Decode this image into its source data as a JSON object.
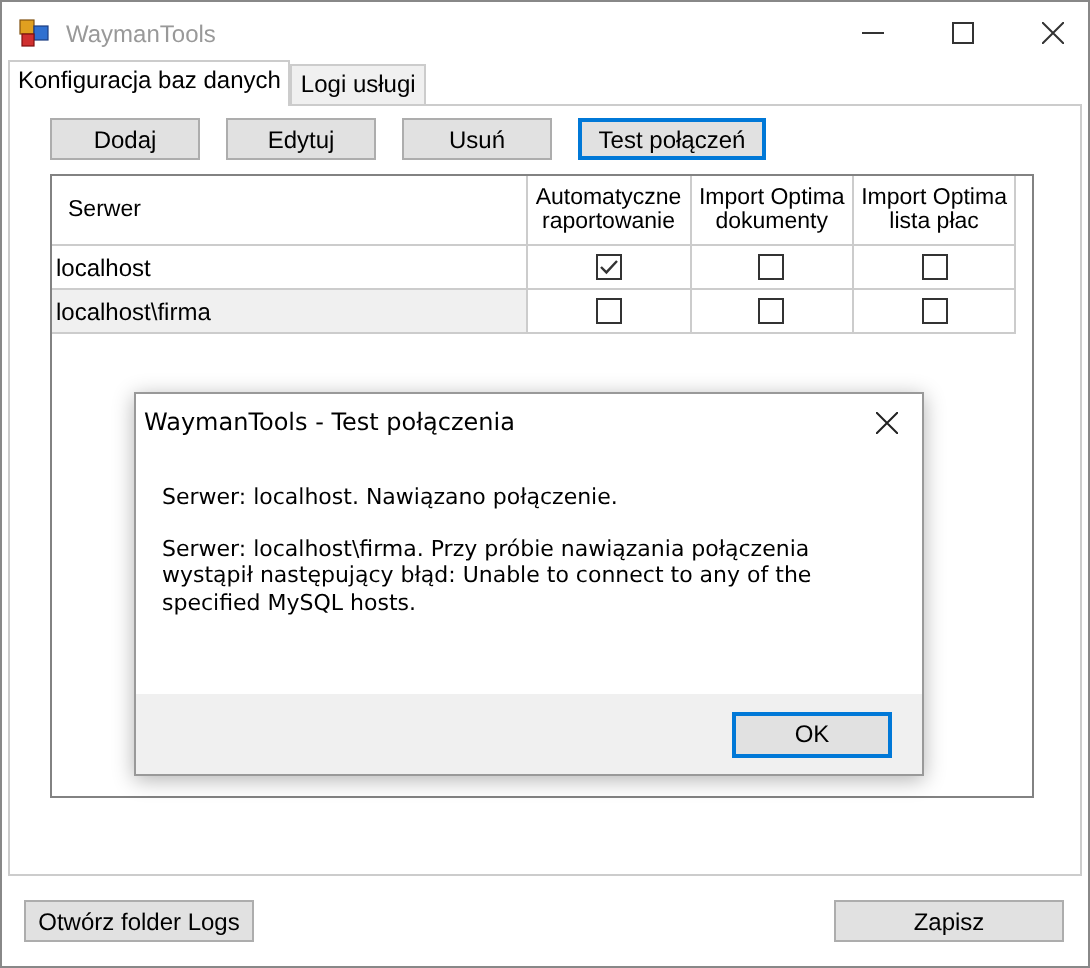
{
  "window": {
    "title": "WaymanTools"
  },
  "tabs": [
    {
      "label": "Konfiguracja baz danych",
      "selected": true
    },
    {
      "label": "Logi usługi",
      "selected": false
    }
  ],
  "toolbar": [
    {
      "label": "Dodaj",
      "focused": false
    },
    {
      "label": "Edytuj",
      "focused": false
    },
    {
      "label": "Usuń",
      "focused": false
    },
    {
      "label": "Test połączeń",
      "focused": true
    }
  ],
  "table": {
    "columns": [
      "Serwer",
      "Automatyczne raportowanie",
      "Import Optima dokumenty",
      "Import Optima lista płac"
    ],
    "rows": [
      {
        "server": "localhost",
        "selected": false,
        "checks": [
          true,
          false,
          false
        ]
      },
      {
        "server": "localhost\\firma",
        "selected": true,
        "checks": [
          false,
          false,
          false
        ]
      }
    ]
  },
  "dialog": {
    "title": "WaymanTools - Test połączenia",
    "messages": [
      "Serwer: localhost. Nawiązano połączenie.",
      "Serwer: localhost\\firma. Przy próbie nawiązania połączenia wystąpił następujący błąd: Unable to connect to any of the specified MySQL hosts."
    ],
    "button": "OK"
  },
  "footer": {
    "left_button": "Otwórz folder Logs",
    "right_button": "Zapisz"
  }
}
